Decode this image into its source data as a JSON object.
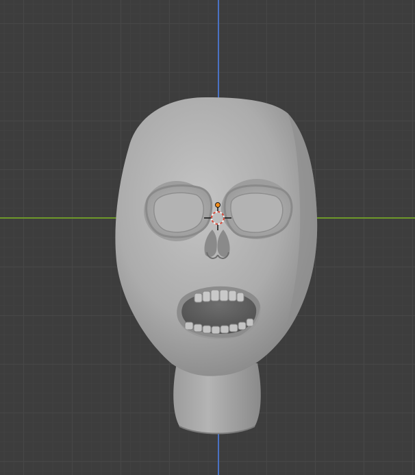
{
  "viewport": {
    "view": "front-orthographic",
    "object": "skull-head-mesh",
    "shading": "solid"
  },
  "colors": {
    "background": "#3d3d3d",
    "grid": "#474747",
    "x_axis": "#6e9a2a",
    "z_axis": "#4a72c4",
    "mesh": "#a9a9a9",
    "origin": "#f28c1a",
    "cursor_red": "#d84a3a"
  }
}
